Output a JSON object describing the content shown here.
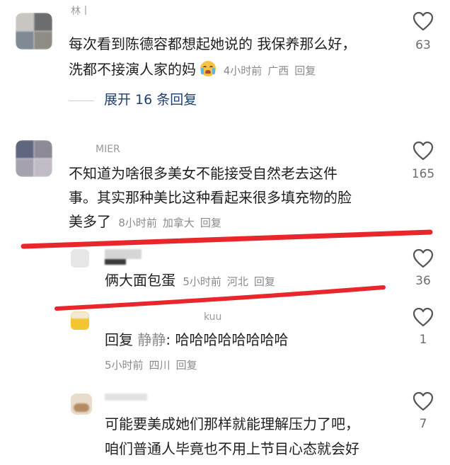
{
  "comments": [
    {
      "username": "林丨",
      "text_line1": "每次看到陈德容都想起她说的 我保养那么好，",
      "text_line2": "洗都不接演人家的妈",
      "time": "4小时前",
      "location": "广西",
      "reply_label": "回复",
      "likes": "63"
    },
    {
      "username": "MIER",
      "text_line1": "不知道为啥很多美女不能接受自然老去这件",
      "text_line2": "事。其实那种美比这种看起来很多填充物的脸",
      "text_line3": "美多了",
      "time": "8小时前",
      "location": "加拿大",
      "reply_label": "回复",
      "likes": "165"
    },
    {
      "username": "",
      "text": "俩大面包蛋",
      "time": "5小时前",
      "location": "河北",
      "reply_label": "回复",
      "likes": "36"
    },
    {
      "username": "kuu",
      "reply_prefix": "回复",
      "reply_to": "静静",
      "text": "哈哈哈哈哈哈哈哈",
      "time": "5小时前",
      "location": "四川",
      "reply_label": "回复",
      "likes": "1"
    },
    {
      "username": "",
      "text_line1": "可能要美成她们那样就能理解压力了吧，",
      "text_line2": "咱们普通人毕竟也不用上节目心态就会好",
      "likes": "7"
    }
  ],
  "expand": {
    "label": "展开 16 条回复"
  },
  "icons": {
    "like": "heart-outline-icon",
    "emoji": "crying-face-emoji-icon"
  },
  "colors": {
    "annotation_red": "#e8262b",
    "link_blue": "#1f3f6b"
  }
}
